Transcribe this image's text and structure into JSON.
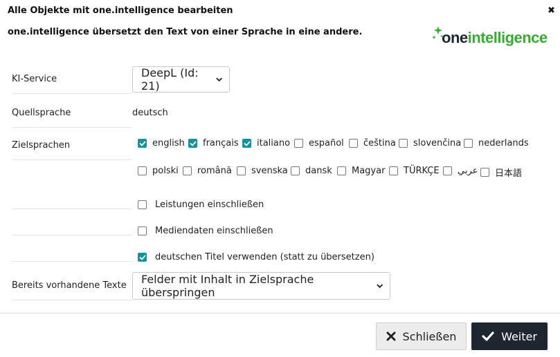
{
  "dialog": {
    "title": "Alle Objekte mit one.intelligence bearbeiten",
    "close_icon": "close-icon",
    "subtitle": "one.intelligence übersetzt den Text von einer Sprache in eine andere.",
    "logo": {
      "prefix": "one",
      "suffix": "intelligence",
      "color": "#3aaa35",
      "spark_color": "#3aaa35"
    }
  },
  "form": {
    "service": {
      "label": "KI-Service",
      "value": "DeepL (Id: 21)"
    },
    "source": {
      "label": "Quellsprache",
      "value": "deutsch"
    },
    "targets": {
      "label": "Zielsprachen",
      "languages": [
        {
          "label": "english",
          "checked": true
        },
        {
          "label": "français",
          "checked": true
        },
        {
          "label": "italiano",
          "checked": true
        },
        {
          "label": "español",
          "checked": false
        },
        {
          "label": "čeština",
          "checked": false
        },
        {
          "label": "slovenčina",
          "checked": false
        },
        {
          "label": "nederlands",
          "checked": false
        },
        {
          "label": "polski",
          "checked": false
        },
        {
          "label": "română",
          "checked": false
        },
        {
          "label": "svenska",
          "checked": false
        },
        {
          "label": "dansk",
          "checked": false
        },
        {
          "label": "Magyar",
          "checked": false
        },
        {
          "label": "TÜRKÇE",
          "checked": false
        },
        {
          "label": "عربي",
          "checked": false
        },
        {
          "label": "日本語",
          "checked": false
        }
      ]
    },
    "options": [
      {
        "label": "Leistungen einschließen",
        "checked": false
      },
      {
        "label": "Mediendaten einschließen",
        "checked": false
      },
      {
        "label": "deutschen Titel verwenden (statt zu übersetzen)",
        "checked": true
      }
    ],
    "existing": {
      "label": "Bereits vorhandene Texte",
      "value": "Felder mit Inhalt in Zielsprache überspringen"
    }
  },
  "buttons": {
    "close": {
      "label": "Schließen",
      "icon": "close-icon"
    },
    "next": {
      "label": "Weiter",
      "icon": "check-icon"
    }
  },
  "colors": {
    "checkbox_checked": "#13929e",
    "primary_button": "#1e2630",
    "secondary_button": "#ececec"
  }
}
